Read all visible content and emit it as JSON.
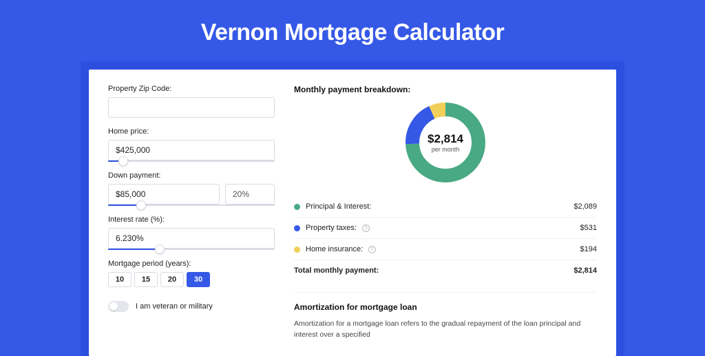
{
  "title": "Vernon Mortgage Calculator",
  "form": {
    "zip": {
      "label": "Property Zip Code:",
      "value": ""
    },
    "price": {
      "label": "Home price:",
      "value": "$425,000",
      "slider_pct": 9
    },
    "down": {
      "label": "Down payment:",
      "amount": "$85,000",
      "pct": "20%",
      "slider_pct": 20
    },
    "rate": {
      "label": "Interest rate (%):",
      "value": "6.230%",
      "slider_pct": 31
    },
    "period": {
      "label": "Mortgage period (years):",
      "options": [
        "10",
        "15",
        "20",
        "30"
      ],
      "selected": "30"
    },
    "veteran": {
      "label": "I am veteran or military",
      "on": false
    }
  },
  "breakdown": {
    "title": "Monthly payment breakdown:",
    "center_value": "$2,814",
    "center_sub": "per month",
    "items": [
      {
        "label": "Principal & Interest:",
        "value": "$2,089",
        "color": "#49a984",
        "info": false
      },
      {
        "label": "Property taxes:",
        "value": "$531",
        "color": "#3558e6",
        "info": true
      },
      {
        "label": "Home insurance:",
        "value": "$194",
        "color": "#f1cf58",
        "info": true
      }
    ],
    "total": {
      "label": "Total monthly payment:",
      "value": "$2,814"
    }
  },
  "amort": {
    "title": "Amortization for mortgage loan",
    "text": "Amortization for a mortgage loan refers to the gradual repayment of the loan principal and interest over a specified"
  },
  "chart_data": {
    "type": "pie",
    "title": "Monthly payment breakdown",
    "categories": [
      "Principal & Interest",
      "Property taxes",
      "Home insurance"
    ],
    "values": [
      2089,
      531,
      194
    ],
    "colors": [
      "#49a984",
      "#3558e6",
      "#f1cf58"
    ],
    "center_label": "$2,814 per month"
  }
}
